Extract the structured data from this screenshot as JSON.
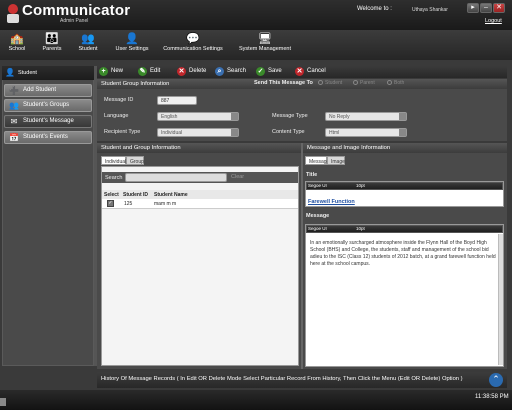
{
  "app": {
    "title": "Communicator",
    "subtitle": "Admin Panel",
    "welcome": "Welcome to :",
    "user": "Uthaya Shankar",
    "logout": "Logout"
  },
  "window_controls": [
    "▸",
    "–",
    "✕"
  ],
  "nav": [
    {
      "label": "School",
      "icon": "school-icon"
    },
    {
      "label": "Parents",
      "icon": "parents-icon"
    },
    {
      "label": "Student",
      "icon": "student-icon"
    },
    {
      "label": "User Settings",
      "icon": "user-settings-icon"
    },
    {
      "label": "Communication Settings",
      "icon": "communication-settings-icon"
    },
    {
      "label": "System Management",
      "icon": "system-management-icon"
    }
  ],
  "sidebar": {
    "title": "Student",
    "items": [
      {
        "label": "Add Student"
      },
      {
        "label": "Student's Groups"
      },
      {
        "label": "Student's Message"
      },
      {
        "label": "Student's Events"
      }
    ],
    "active_index": 2
  },
  "toolbar": {
    "new": "New",
    "edit": "Edit",
    "delete": "Delete",
    "search": "Search",
    "save": "Save",
    "cancel": "Cancel"
  },
  "group_info": {
    "header": "Student Group Information",
    "send_label": "Send This Message To",
    "send_options": [
      "Student",
      "Parent",
      "Both"
    ],
    "message_id_label": "Message ID",
    "message_id": "887",
    "language_label": "Language",
    "language": "English",
    "message_type_label": "Message Type",
    "message_type": "No Reply",
    "recipient_type_label": "Recipient Type",
    "recipient_type": "Individual",
    "content_type_label": "Content Type",
    "content_type": "Html"
  },
  "student_group": {
    "header": "Student and Group Information",
    "tabs": [
      "Individual",
      "Group"
    ],
    "search_label": "Search",
    "clear": "Clear",
    "columns": [
      "Select",
      "Student ID",
      "Student Name"
    ],
    "rows": [
      {
        "selected": true,
        "id": "125",
        "name": "mam m m"
      }
    ]
  },
  "message_image": {
    "header": "Message and Image Information",
    "tabs": [
      "Message",
      "Image"
    ],
    "title_label": "Title",
    "font": "Segoe UI",
    "size": "10pt",
    "title_text": "Farewell Function",
    "message_label": "Message",
    "message_text": "In an emotionally surcharged atmosphere inside the Flynn Hall of the Boyd High School (BHS) and College, the students, staff and management of the school bid adieu to the ISC (Class 12) students of 2012 batch, at a grand farewell function held here at the school campus."
  },
  "history": "History Of Message Records ( In Edit OR Delete Mode Select Particular Record From History, Then Click the Menu (Edit OR Delete) Option )",
  "clock": "11:38:58 PM",
  "colors": {
    "new": "#3a8a2a",
    "edit": "#3a8a2a",
    "delete": "#c0262b",
    "search": "#3a6fb0",
    "save": "#3a8a2a",
    "cancel": "#c0262b",
    "link": "#1f4fa0"
  }
}
